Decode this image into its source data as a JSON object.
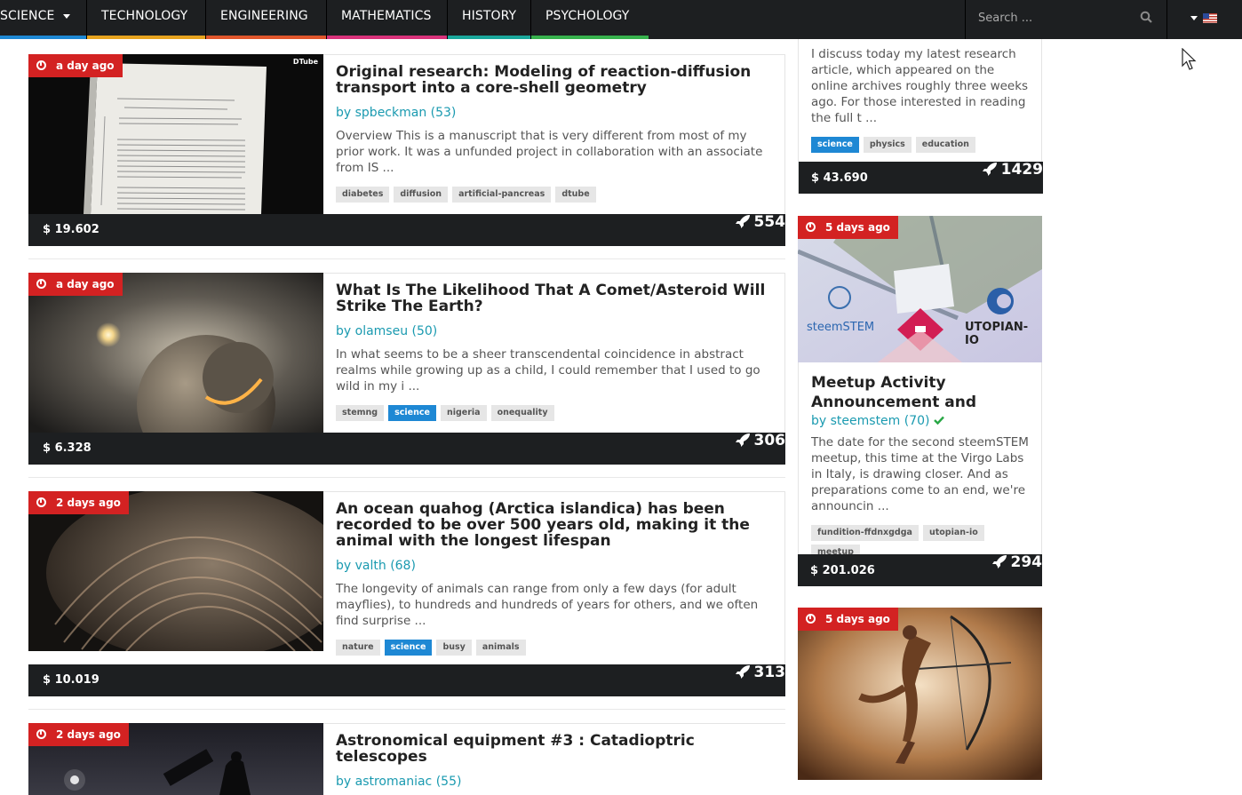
{
  "nav": {
    "items": [
      {
        "label": "SCIENCE",
        "color": "#1e88d4"
      },
      {
        "label": "TECHNOLOGY",
        "color": "#e6a31e"
      },
      {
        "label": "ENGINEERING",
        "color": "#e0562b"
      },
      {
        "label": "MATHEMATICS",
        "color": "#d9327a"
      },
      {
        "label": "HISTORY",
        "color": "#1aa79b"
      },
      {
        "label": "PSYCHOLOGY",
        "color": "#37b24d"
      }
    ],
    "search_placeholder": "Search ...",
    "search_icon": "search-icon",
    "language_icon": "us-flag-icon"
  },
  "posts": [
    {
      "age": "a day ago",
      "title": "Original research: Modeling of reaction-diffusion transport into a core-shell geometry",
      "author": "by spbeckman (53)",
      "excerpt": "Overview This is a manuscript that is very different from most of my prior work. It was a unfunded project in collaboration with an associate from IS ...",
      "tags": [
        {
          "label": "diabetes",
          "highlight": false
        },
        {
          "label": "diffusion",
          "highlight": false
        },
        {
          "label": "artificial-pancreas",
          "highlight": false
        },
        {
          "label": "dtube",
          "highlight": false
        }
      ],
      "price": "$ 19.602",
      "votes": "554",
      "thumb_caption": "DTube"
    },
    {
      "age": "a day ago",
      "title": "What Is The Likelihood That A Comet/Asteroid Will Strike The Earth?",
      "author": "by olamseu (50)",
      "excerpt": "In what seems to be a sheer transcendental coincidence in abstract realms while growing up as a child, I could remember that I used to go wild in my i ...",
      "tags": [
        {
          "label": "stemng",
          "highlight": false
        },
        {
          "label": "science",
          "highlight": true
        },
        {
          "label": "nigeria",
          "highlight": false
        },
        {
          "label": "onequality",
          "highlight": false
        }
      ],
      "price": "$ 6.328",
      "votes": "306"
    },
    {
      "age": "2 days ago",
      "title": "An ocean quahog (Arctica islandica) has been recorded to be over 500 years old, making it the animal with the longest lifespan",
      "author": "by valth (68)",
      "excerpt": "The longevity of animals can range from only a few days (for adult mayflies), to hundreds and hundreds of years for others, and we often find surprise ...",
      "tags": [
        {
          "label": "nature",
          "highlight": false
        },
        {
          "label": "science",
          "highlight": true
        },
        {
          "label": "busy",
          "highlight": false
        },
        {
          "label": "animals",
          "highlight": false
        }
      ],
      "price": "$ 10.019",
      "votes": "313"
    },
    {
      "age": "2 days ago",
      "title": "Astronomical equipment #3 : Catadioptric telescopes",
      "author": "by astromaniac (55)"
    }
  ],
  "sidebar": [
    {
      "excerpt": "I discuss today my latest research article, which appeared on the online archives roughly three weeks ago. For those interested in reading the full t ...",
      "tags": [
        {
          "label": "science",
          "highlight": true
        },
        {
          "label": "physics",
          "highlight": false
        },
        {
          "label": "education",
          "highlight": false
        }
      ],
      "price": "$ 43.690",
      "votes": "1429"
    },
    {
      "age": "5 days ago",
      "banner_left": "steemSTEM",
      "banner_right": "UTOPIAN-IO",
      "title": "Meetup Activity Announcement and",
      "author": "by steemstem (70)",
      "excerpt": "The date for the second steemSTEM meetup, this time at the Virgo Labs in Italy, is drawing closer. And as preparations come to an end, we're announcin ...",
      "tags": [
        {
          "label": "fundition-ffdnxgdga",
          "highlight": false
        },
        {
          "label": "utopian-io",
          "highlight": false
        },
        {
          "label": "meetup",
          "highlight": false
        }
      ],
      "price": "$ 201.026",
      "votes": "294"
    },
    {
      "age": "5 days ago"
    }
  ]
}
